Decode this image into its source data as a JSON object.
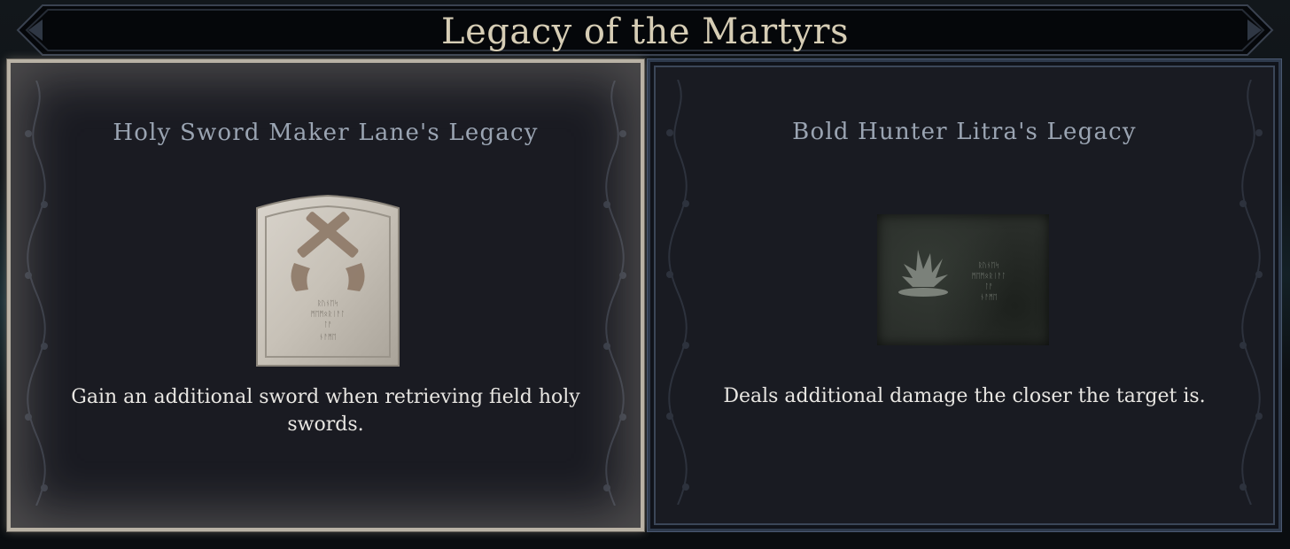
{
  "title": "Legacy of the Martyrs",
  "cards": [
    {
      "title": "Holy Sword Maker Lane's Legacy",
      "description": "Gain an additional sword when retrieving field holy swords.",
      "icon": "crossed-pistols-tombstone-icon",
      "inscription": [
        "ᚱᚢᚾᛖᛋ",
        "ᛗᛖᛗᛟᚱᛁᚨᛚ",
        "ᛚᚨ",
        "ᚾᚨᛗᛖ"
      ],
      "selected": true
    },
    {
      "title": "Bold Hunter Litra's Legacy",
      "description": "Deals additional damage the closer the target is.",
      "icon": "impact-burst-plaque-icon",
      "inscription": [
        "ᚱᚢᚾᛖᛋ",
        "ᛗᛖᛗᛟᚱᛁᚨᛚ",
        "ᛚᚨ",
        "ᚾᚨᛗᛖ"
      ],
      "selected": false
    }
  ],
  "colors": {
    "title": "#d6cdb5",
    "card_title": "#9aa4b2",
    "description": "#e8e6e2",
    "selected_border": "#b9b2a5",
    "unselected_border": "#2e3a4c"
  }
}
